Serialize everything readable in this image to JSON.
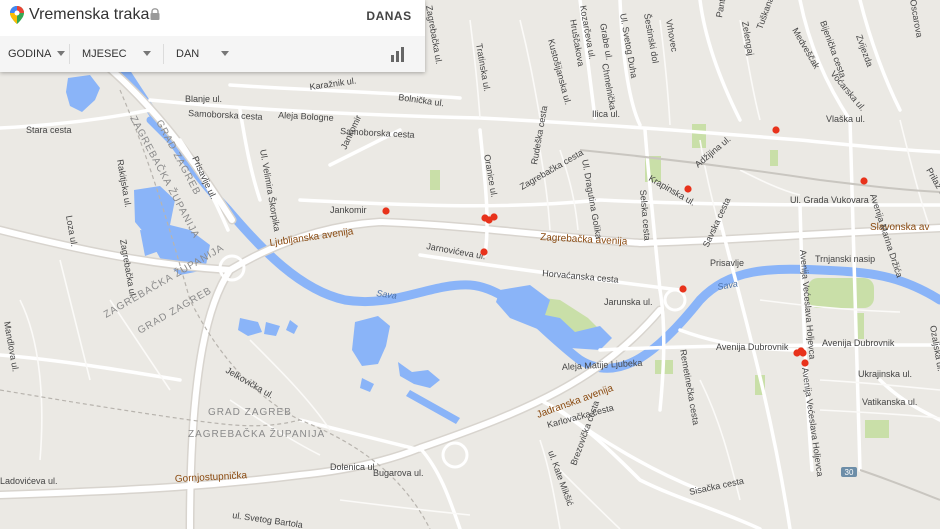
{
  "app": {
    "title": "Vremenska traka",
    "today_label": "DANAS"
  },
  "filters": {
    "year_label": "GODINA",
    "month_label": "MJESEC",
    "day_label": "DAN"
  },
  "icons": {
    "logo": "google-maps-pin-icon",
    "lock": "lock-icon",
    "chart": "bar-chart-icon",
    "caret": "caret-down-icon"
  },
  "colors": {
    "land": "#ebe9e4",
    "water": "#8ab4f8",
    "park": "#c9dfa8",
    "road": "#ffffff",
    "marker": "#e8321b"
  },
  "map": {
    "streets": {
      "blanje": "Blanje ul.",
      "samoborska_1": "Samoborska cesta",
      "aleja_bologne": "Aleja Bologne",
      "samoborska_2": "Samoborska cesta",
      "karaznik": "Karažnik ul.",
      "bolnicka": "Bolnička ul.",
      "stara_cesta": "Stara cesta",
      "prisavlje_ul": "Prisavlje ul.",
      "ljubljanska": "Ljubljanska avenija",
      "jankomir": "Jankomir",
      "zagrebacka_av": "Zagrebačka avenija",
      "jarnoviceva": "Jarnovićeva ul.",
      "horvacanska": "Horvaćanska cesta",
      "jaruska": "Jarunska ul.",
      "prisavlje": "Prisavlje",
      "trnjanski": "Trnjanski nasip",
      "aleja_ljudevita": "Aleja Matije Ljubeka",
      "av_dubrovnik_1": "Avenija Dubrovnik",
      "av_dubrovnik_2": "Avenija Dubrovnik",
      "jadranska": "Jadranska avenija",
      "ukrajinska": "Ukrajinska ul.",
      "vatikanska": "Vatikanska ul.",
      "gornjostupnicka": "Gornjostupnička",
      "bugarova": "Bugarova ul.",
      "dolenica": "Dolenica ul.",
      "jelkoviceva": "Jelkovička ul.",
      "sv_gog": "ul. Svetog Bartola",
      "grada_vukovara": "Ul. Grada Vukovara",
      "slavonska": "Slavonska av",
      "krapinska": "Krapinska ul.",
      "adzijina": "Adžijina ul.",
      "ilica": "Ilica ul.",
      "vlaska": "Vlaška ul.",
      "vocarska": "Voćarska ul.",
      "savska": "Savska cesta",
      "av_vecaslava_1": "Avenija Većeslava Holjevca",
      "av_vecaslava_2": "Avenija Većeslava Holjevca",
      "av_marina_drzica": "Avenija Marina Držića",
      "remetinecka": "Remetinečka cesta",
      "karlovacka": "Karlovačka cesta",
      "ul_kate": "ul. Kate Mikšić",
      "brezovicka": "Brezovička cesta",
      "sisacka": "Sisačka cesta",
      "prisavlje_ul2": "Rakitjska ul.",
      "zagrebacka_ul": "Zagrebačka ul.",
      "prisavljska": "Prisavlje ul.",
      "v_skrinjara": "Ul. Velimira Škorpika",
      "rudes": "Rudeška cesta",
      "zagrebacka_c": "Zagrebačka cesta",
      "dragutina": "Ul. Dragutina Golika",
      "selska": "Selska cesta",
      "prilaz": "Prilaz Gjure",
      "ozaljska": "Ozaljska ul.",
      "lozicka": "Loza ul.",
      "jankomir_ul": "Jankomir",
      "oranice": "Oranice ul.",
      "tratinska": "Tratinska ul.",
      "ladislava": "Ladovićeva ul.",
      "mandlova": "Mandlova ul.",
      "pantovcak": "Pantovčak",
      "zelengaj": "Zelengaj",
      "tuskanac": "Tuškanac",
      "medvescak": "Medveščak",
      "bijenicka": "Bijenička cesta",
      "zvijezda": "Zvijezda",
      "kozarceva": "Kozarčeva ul.",
      "sveti_duh": "Ul. Svetog Duha",
      "grabe": "Grabe ul.",
      "vrhovec": "Vrhovec",
      "sestinski": "Šestinski dol",
      "chmelnicki": "Chmelnička",
      "kustosijanska": "Kustošijanska ul.",
      "hruscakova": "Hruščakova",
      "zagrebacka_ul2": "Zagrebačka ul.",
      "jadranska2": "Jadranska",
      "oscarova": "Oscarova",
      "sv_bartola": "ul. Svetog Bartola"
    },
    "water": {
      "sava_1": "Sava",
      "sava_2": "Sava"
    },
    "regions": {
      "grad_zagreb_1": "GRAD ZAGREB",
      "zagrebacka_1": "ZAGREBAČKA ŽUPANIJA",
      "zagrebacka_2": "ZAGREBAČKA ŽUPANIJA",
      "grad_zagreb_2": "GRAD ZAGREB",
      "grad_zagreb_3": "GRAD ZAGREB",
      "zagrebacka_3": "ZAGREBAČKA ŽUPANIJA"
    },
    "highway_shield": "30",
    "markers": [
      {
        "id": "m1"
      },
      {
        "id": "m2"
      },
      {
        "id": "m3"
      },
      {
        "id": "m4"
      },
      {
        "id": "m5"
      },
      {
        "id": "m6"
      },
      {
        "id": "m7"
      },
      {
        "id": "m8"
      },
      {
        "id": "m9"
      },
      {
        "id": "m10"
      },
      {
        "id": "m11"
      },
      {
        "id": "m12"
      },
      {
        "id": "m13"
      }
    ]
  }
}
